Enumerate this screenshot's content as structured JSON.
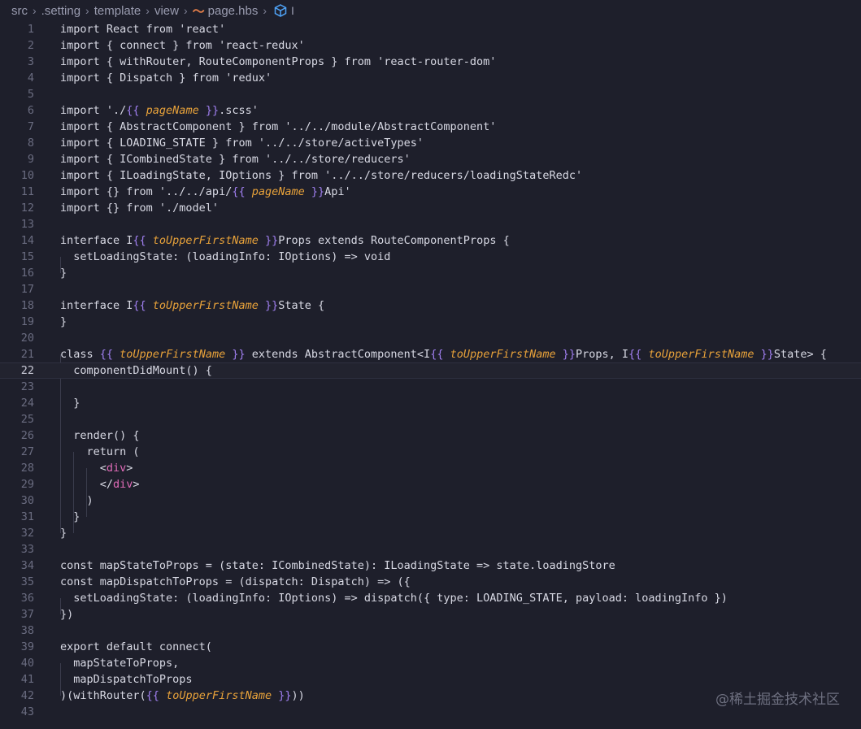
{
  "breadcrumb": {
    "items": [
      "src",
      ".setting",
      "template",
      "view"
    ],
    "file_icon": "handlebars-file-icon",
    "file": "page.hbs",
    "symbol_icon": "cube-icon",
    "symbol": "I"
  },
  "watermark": "@稀土掘金技术社区",
  "editor": {
    "active_line": 22,
    "lines": [
      [
        [
          "kw",
          "import React from 'react'"
        ]
      ],
      [
        [
          "kw",
          "import { connect } from 'react-redux'"
        ]
      ],
      [
        [
          "kw",
          "import { withRouter, RouteComponentProps } from 'react-router-dom'"
        ]
      ],
      [
        [
          "kw",
          "import { Dispatch } from 'redux'"
        ]
      ],
      [],
      [
        [
          "kw",
          "import './"
        ],
        [
          "br",
          "{{ "
        ],
        [
          "var",
          "pageName"
        ],
        [
          "br",
          " }}"
        ],
        [
          "kw",
          ".scss'"
        ]
      ],
      [
        [
          "kw",
          "import { AbstractComponent } from '../../module/AbstractComponent'"
        ]
      ],
      [
        [
          "kw",
          "import { LOADING_STATE } from '../../store/activeTypes'"
        ]
      ],
      [
        [
          "kw",
          "import { ICombinedState } from '../../store/reducers'"
        ]
      ],
      [
        [
          "kw",
          "import { ILoadingState, IOptions } from '../../store/reducers/loadingStateRedc'"
        ]
      ],
      [
        [
          "kw",
          "import {} from '../../api/"
        ],
        [
          "br",
          "{{ "
        ],
        [
          "var",
          "pageName"
        ],
        [
          "br",
          " }}"
        ],
        [
          "kw",
          "Api'"
        ]
      ],
      [
        [
          "kw",
          "import {} from './model'"
        ]
      ],
      [],
      [
        [
          "kw",
          "interface I"
        ],
        [
          "br",
          "{{ "
        ],
        [
          "var",
          "toUpperFirstName"
        ],
        [
          "br",
          " }}"
        ],
        [
          "kw",
          "Props extends RouteComponentProps {"
        ]
      ],
      [
        [
          "kw",
          "  setLoadingState: (loadingInfo: IOptions) => void"
        ]
      ],
      [
        [
          "kw",
          "}"
        ]
      ],
      [],
      [
        [
          "kw",
          "interface I"
        ],
        [
          "br",
          "{{ "
        ],
        [
          "var",
          "toUpperFirstName"
        ],
        [
          "br",
          " }}"
        ],
        [
          "kw",
          "State {"
        ]
      ],
      [
        [
          "kw",
          "}"
        ]
      ],
      [],
      [
        [
          "kw",
          "class "
        ],
        [
          "br",
          "{{ "
        ],
        [
          "var",
          "toUpperFirstName"
        ],
        [
          "br",
          " }}"
        ],
        [
          "kw",
          " extends AbstractComponent<I"
        ],
        [
          "br",
          "{{ "
        ],
        [
          "var",
          "toUpperFirstName"
        ],
        [
          "br",
          " }}"
        ],
        [
          "kw",
          "Props, I"
        ],
        [
          "br",
          "{{ "
        ],
        [
          "var",
          "toUpperFirstName"
        ],
        [
          "br",
          " }}"
        ],
        [
          "kw",
          "State> {"
        ]
      ],
      [
        [
          "kw",
          "  componentDidMount() {"
        ]
      ],
      [],
      [
        [
          "kw",
          "  }"
        ]
      ],
      [],
      [
        [
          "kw",
          "  render() {"
        ]
      ],
      [
        [
          "kw",
          "    return ("
        ]
      ],
      [
        [
          "kw",
          "      <"
        ],
        [
          "tag",
          "div"
        ],
        [
          "kw",
          ">"
        ]
      ],
      [
        [
          "kw",
          "      </"
        ],
        [
          "tag",
          "div"
        ],
        [
          "kw",
          ">"
        ]
      ],
      [
        [
          "kw",
          "    )"
        ]
      ],
      [
        [
          "kw",
          "  }"
        ]
      ],
      [
        [
          "kw",
          "}"
        ]
      ],
      [],
      [
        [
          "kw",
          "const mapStateToProps = (state: ICombinedState): ILoadingState => state.loadingStore"
        ]
      ],
      [
        [
          "kw",
          "const mapDispatchToProps = (dispatch: Dispatch) => ({"
        ]
      ],
      [
        [
          "kw",
          "  setLoadingState: (loadingInfo: IOptions) => dispatch({ type: LOADING_STATE, payload: loadingInfo })"
        ]
      ],
      [
        [
          "kw",
          "})"
        ]
      ],
      [],
      [
        [
          "kw",
          "export default connect("
        ]
      ],
      [
        [
          "kw",
          "  mapStateToProps,"
        ]
      ],
      [
        [
          "kw",
          "  mapDispatchToProps"
        ]
      ],
      [
        [
          "kw",
          ")(withRouter("
        ],
        [
          "br",
          "{{ "
        ],
        [
          "var",
          "toUpperFirstName"
        ],
        [
          "br",
          " }}"
        ],
        [
          "kw",
          "))"
        ]
      ],
      []
    ]
  }
}
